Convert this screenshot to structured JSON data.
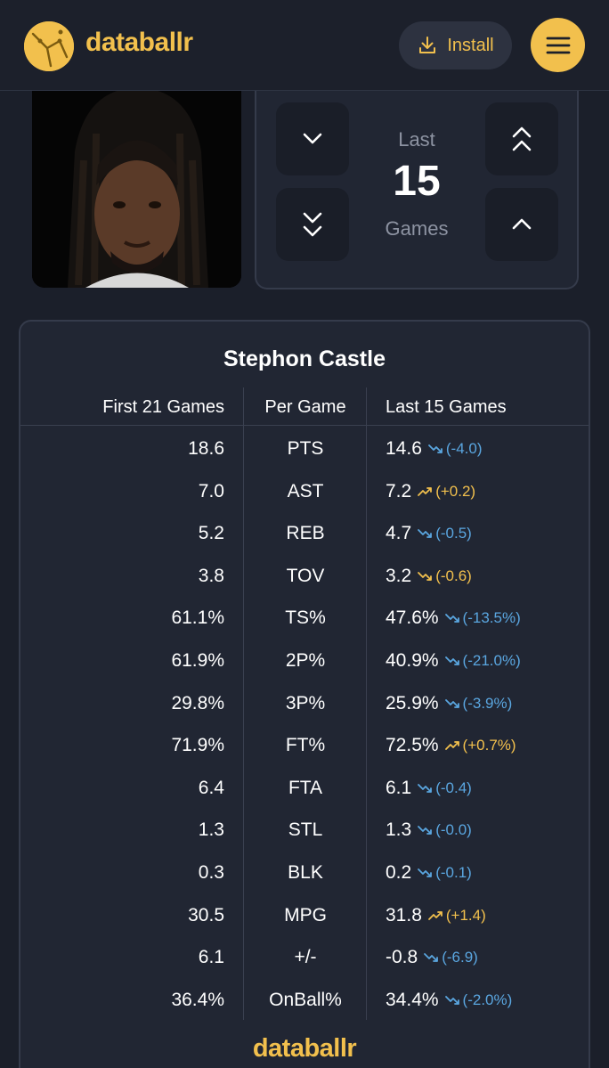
{
  "header": {
    "brand": "databallr",
    "install_label": "Install"
  },
  "selector": {
    "top_word": "Last",
    "count": "15",
    "bottom_word": "Games"
  },
  "stats_card": {
    "player_name": "Stephon Castle",
    "columns": {
      "first": "First 21 Games",
      "per": "Per Game",
      "last": "Last 15 Games"
    },
    "rows": [
      {
        "first": "18.6",
        "stat": "PTS",
        "last": "14.6",
        "delta": "(-4.0)",
        "trend": "down"
      },
      {
        "first": "7.0",
        "stat": "AST",
        "last": "7.2",
        "delta": "(+0.2)",
        "trend": "up"
      },
      {
        "first": "5.2",
        "stat": "REB",
        "last": "4.7",
        "delta": "(-0.5)",
        "trend": "down"
      },
      {
        "first": "3.8",
        "stat": "TOV",
        "last": "3.2",
        "delta": "(-0.6)",
        "trend": "neg"
      },
      {
        "first": "61.1%",
        "stat": "TS%",
        "last": "47.6%",
        "delta": "(-13.5%)",
        "trend": "down"
      },
      {
        "first": "61.9%",
        "stat": "2P%",
        "last": "40.9%",
        "delta": "(-21.0%)",
        "trend": "down"
      },
      {
        "first": "29.8%",
        "stat": "3P%",
        "last": "25.9%",
        "delta": "(-3.9%)",
        "trend": "down"
      },
      {
        "first": "71.9%",
        "stat": "FT%",
        "last": "72.5%",
        "delta": "(+0.7%)",
        "trend": "up"
      },
      {
        "first": "6.4",
        "stat": "FTA",
        "last": "6.1",
        "delta": "(-0.4)",
        "trend": "down"
      },
      {
        "first": "1.3",
        "stat": "STL",
        "last": "1.3",
        "delta": "(-0.0)",
        "trend": "down"
      },
      {
        "first": "0.3",
        "stat": "BLK",
        "last": "0.2",
        "delta": "(-0.1)",
        "trend": "down"
      },
      {
        "first": "30.5",
        "stat": "MPG",
        "last": "31.8",
        "delta": "(+1.4)",
        "trend": "up"
      },
      {
        "first": "6.1",
        "stat": "+/-",
        "last": "-0.8",
        "delta": "(-6.9)",
        "trend": "down"
      },
      {
        "first": "36.4%",
        "stat": "OnBall%",
        "last": "34.4%",
        "delta": "(-2.0%)",
        "trend": "down"
      }
    ],
    "footer_brand": "databallr"
  },
  "colors": {
    "accent": "#f2c04d",
    "background": "#1b1f2a",
    "card": "#212633",
    "trend_down": "#5aa6e0",
    "trend_up": "#f2c04d"
  },
  "icons": {
    "logo": "basketball-logo-icon",
    "install": "download-icon",
    "menu": "hamburger-menu-icon",
    "decrease_one": "chevron-down-icon",
    "decrease_many": "double-chevron-down-icon",
    "increase_many": "double-chevron-up-icon",
    "increase_one": "chevron-up-icon",
    "trend_up": "trend-up-icon",
    "trend_down": "trend-down-icon"
  }
}
